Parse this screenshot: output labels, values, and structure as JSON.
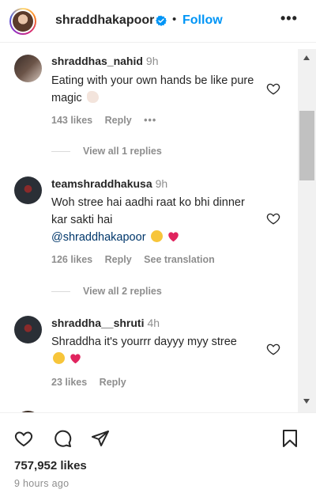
{
  "header": {
    "username": "shraddhakapoor",
    "separator": "•",
    "follow_label": "Follow",
    "more_label": "•••"
  },
  "comments": [
    {
      "username": "shraddhas_nahid",
      "time": "9h",
      "text": "Eating with your own hands be like pure magic",
      "emoji": "folded-hands",
      "likes": "143 likes",
      "reply": "Reply",
      "more": "•••",
      "view_replies": "View all 1 replies"
    },
    {
      "username": "teamshraddhakusa",
      "time": "9h",
      "text": "Woh stree hai aadhi raat ko bhi dinner kar sakti hai",
      "mention": "@shraddhakapoor",
      "emojis": [
        "laughing-face",
        "red-heart"
      ],
      "likes": "126 likes",
      "reply": "Reply",
      "translation": "See translation",
      "view_replies": "View all 2 replies"
    },
    {
      "username": "shraddha__shruti",
      "time": "4h",
      "text": "Shraddha it's yourrr dayyy myy stree",
      "emojis": [
        "winking-tongue-face",
        "red-heart"
      ],
      "likes": "23 likes",
      "reply": "Reply"
    }
  ],
  "footer": {
    "likes": "757,952 likes",
    "time_ago": "9 hours ago"
  },
  "colors": {
    "link_blue": "#0095f6",
    "mention_blue": "#00376b",
    "muted_text": "#8e8e8e",
    "primary_text": "#262626"
  }
}
